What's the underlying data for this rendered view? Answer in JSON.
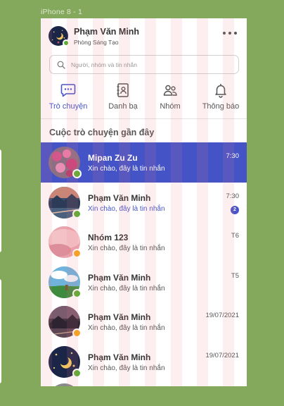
{
  "frame_label": "iPhone 8 - 1",
  "user": {
    "name": "Phạm Văn Minh",
    "department": "Phòng Sáng Tạo",
    "status": "online"
  },
  "search": {
    "placeholder": "Người, nhóm và tin nhắn",
    "icon": "search-icon"
  },
  "tabs": [
    {
      "label": "Trò chuyện",
      "icon": "chat-bubble-icon",
      "active": true
    },
    {
      "label": "Danh bạ",
      "icon": "contacts-book-icon",
      "active": false
    },
    {
      "label": "Nhóm",
      "icon": "group-icon",
      "active": false
    },
    {
      "label": "Thông báo",
      "icon": "bell-icon",
      "active": false
    }
  ],
  "section_title": "Cuộc trò chuyện gần đây",
  "conversations": [
    {
      "name": "Mipan Zu Zu",
      "message": "Xin chào, đây là tin nhắn",
      "time": "7:30",
      "status": "online",
      "selected": true
    },
    {
      "name": "Phạm Văn Minh",
      "message": "Xin chào, đây là tin nhắn",
      "time": "7:30",
      "status": "online",
      "unread": "2"
    },
    {
      "name": "Nhóm 123",
      "message": "Xin chào, đây là tin nhắn",
      "time": "T6",
      "status": "away"
    },
    {
      "name": "Phạm Văn Minh",
      "message": "Xin chào, đây là tin nhắn",
      "time": "T5",
      "status": "online"
    },
    {
      "name": "Phạm Văn Minh",
      "message": "Xin chào, đây là tin nhắn",
      "time": "19/07/2021",
      "status": "away"
    },
    {
      "name": "Phạm Văn Minh",
      "message": "Xin chào, đây là tin nhắn",
      "time": "19/07/2021",
      "status": "online"
    }
  ],
  "colors": {
    "accent": "#4755c9",
    "selected_row": "#4453c6",
    "online": "#5cae33",
    "away": "#f6a521",
    "background": "#84a85c"
  }
}
